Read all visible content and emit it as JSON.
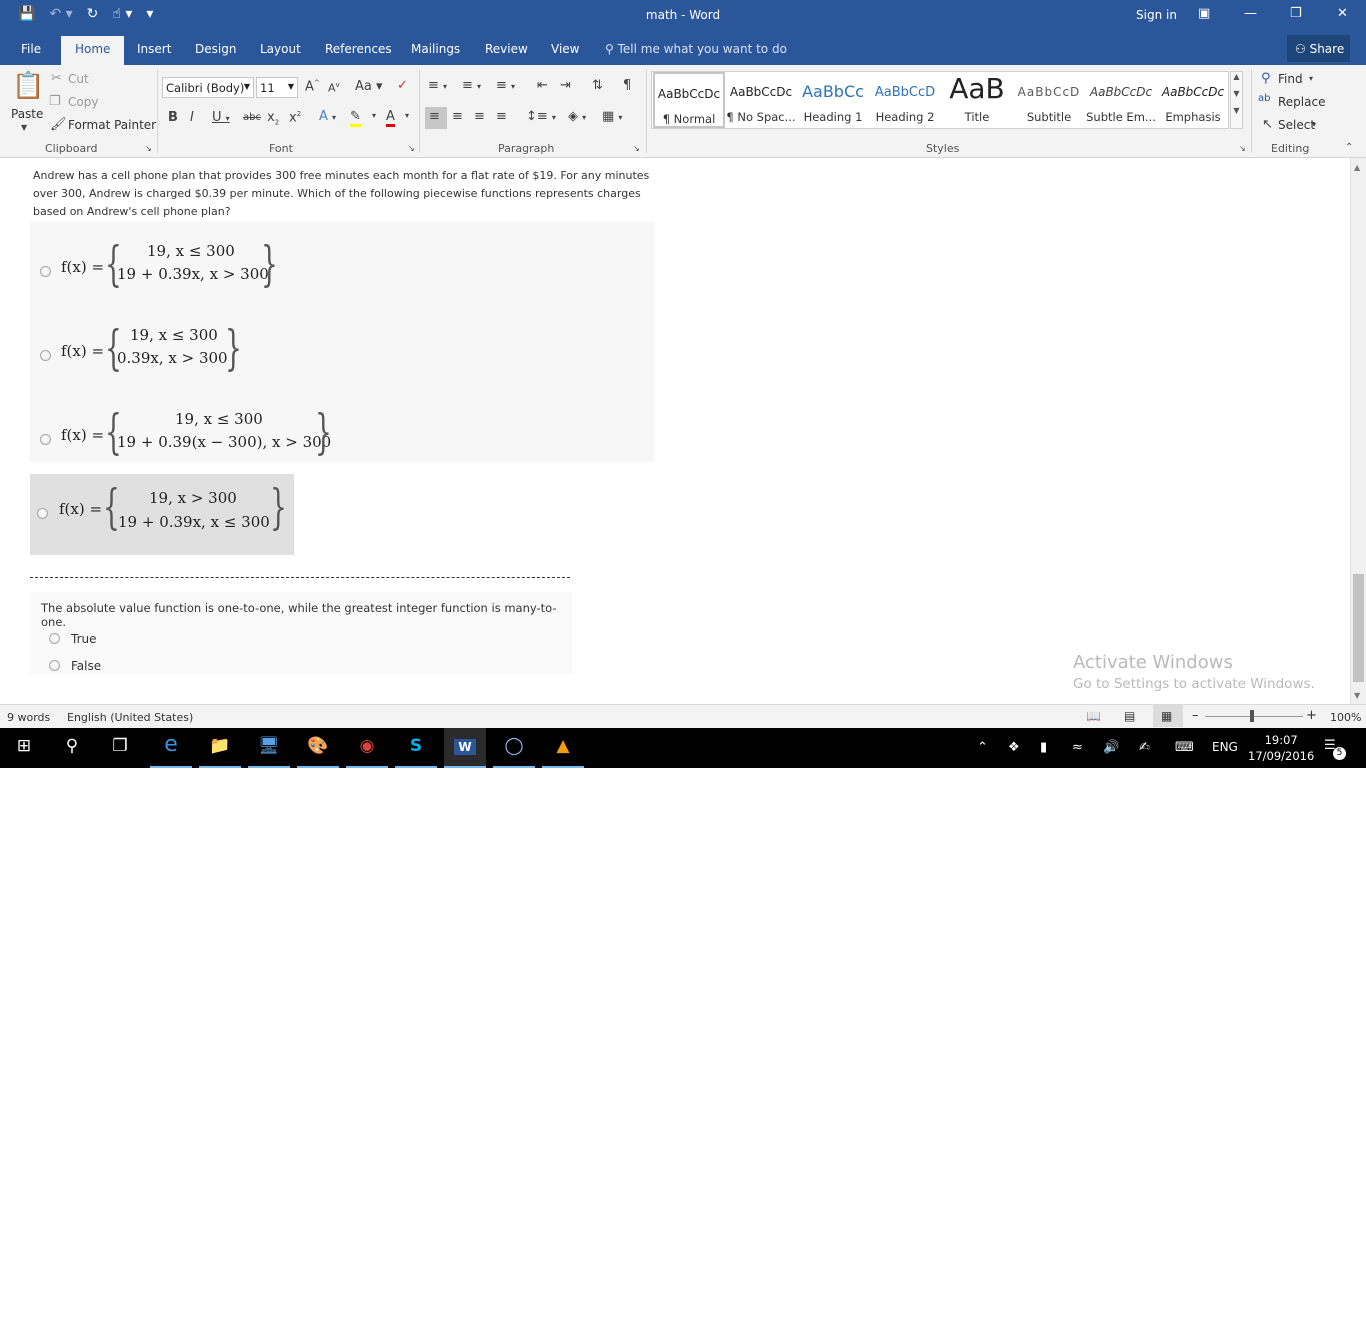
{
  "window": {
    "title": "math - Word",
    "sign_in": "Sign in",
    "qat": {
      "save_icon": "save-icon",
      "undo_icon": "undo-icon",
      "redo_icon": "redo-icon",
      "touch_icon": "touch-mode-icon"
    }
  },
  "tabs": [
    "File",
    "Home",
    "Insert",
    "Design",
    "Layout",
    "References",
    "Mailings",
    "Review",
    "View"
  ],
  "tell_me": "Tell me what you want to do",
  "share": "Share",
  "clipboard": {
    "paste": "Paste",
    "cut": "Cut",
    "copy": "Copy",
    "format_painter": "Format Painter",
    "label": "Clipboard"
  },
  "font": {
    "family": "Calibri (Body)",
    "size": "11",
    "label": "Font"
  },
  "paragraph": {
    "label": "Paragraph"
  },
  "styles": {
    "label": "Styles",
    "items": [
      {
        "preview": "AaBbCcDc",
        "name": "¶ Normal"
      },
      {
        "preview": "AaBbCcDc",
        "name": "¶ No Spac..."
      },
      {
        "preview": "AaBbCc",
        "name": "Heading 1"
      },
      {
        "preview": "AaBbCcD",
        "name": "Heading 2"
      },
      {
        "preview": "AaB",
        "name": "Title"
      },
      {
        "preview": "AaBbCcD",
        "name": "Subtitle"
      },
      {
        "preview": "AaBbCcDc",
        "name": "Subtle Em..."
      },
      {
        "preview": "AaBbCcDc",
        "name": "Emphasis"
      }
    ]
  },
  "editing": {
    "find": "Find",
    "replace": "Replace",
    "select": "Select",
    "label": "Editing"
  },
  "document": {
    "question1": "Andrew has a cell phone plan that provides 300 free minutes each month for a flat rate of $19. For any minutes over 300, Andrew is charged $0.39 per minute. Which of the following piecewise functions represents charges based on Andrew's cell phone plan?",
    "fx": "f(x) =",
    "options": [
      {
        "top": "19, x ≤ 300",
        "bottom": "19 + 0.39x, x > 300"
      },
      {
        "top": "19, x ≤ 300",
        "bottom": "0.39x, x > 300"
      },
      {
        "top": "19, x ≤ 300",
        "bottom": "19 + 0.39(x − 300), x > 300"
      },
      {
        "top": "19, x > 300",
        "bottom": "19 + 0.39x, x ≤ 300"
      }
    ],
    "question2": "The absolute value function is one-to-one, while the greatest integer function is many-to-one.",
    "true_label": "True",
    "false_label": "False",
    "watermark_title": "Activate Windows",
    "watermark_sub": "Go to Settings to activate Windows."
  },
  "status": {
    "words": "9 words",
    "language": "English (United States)",
    "zoom": "100%"
  },
  "taskbar": {
    "language": "ENG",
    "time": "19:07",
    "date": "17/09/2016",
    "notifications": "5"
  }
}
